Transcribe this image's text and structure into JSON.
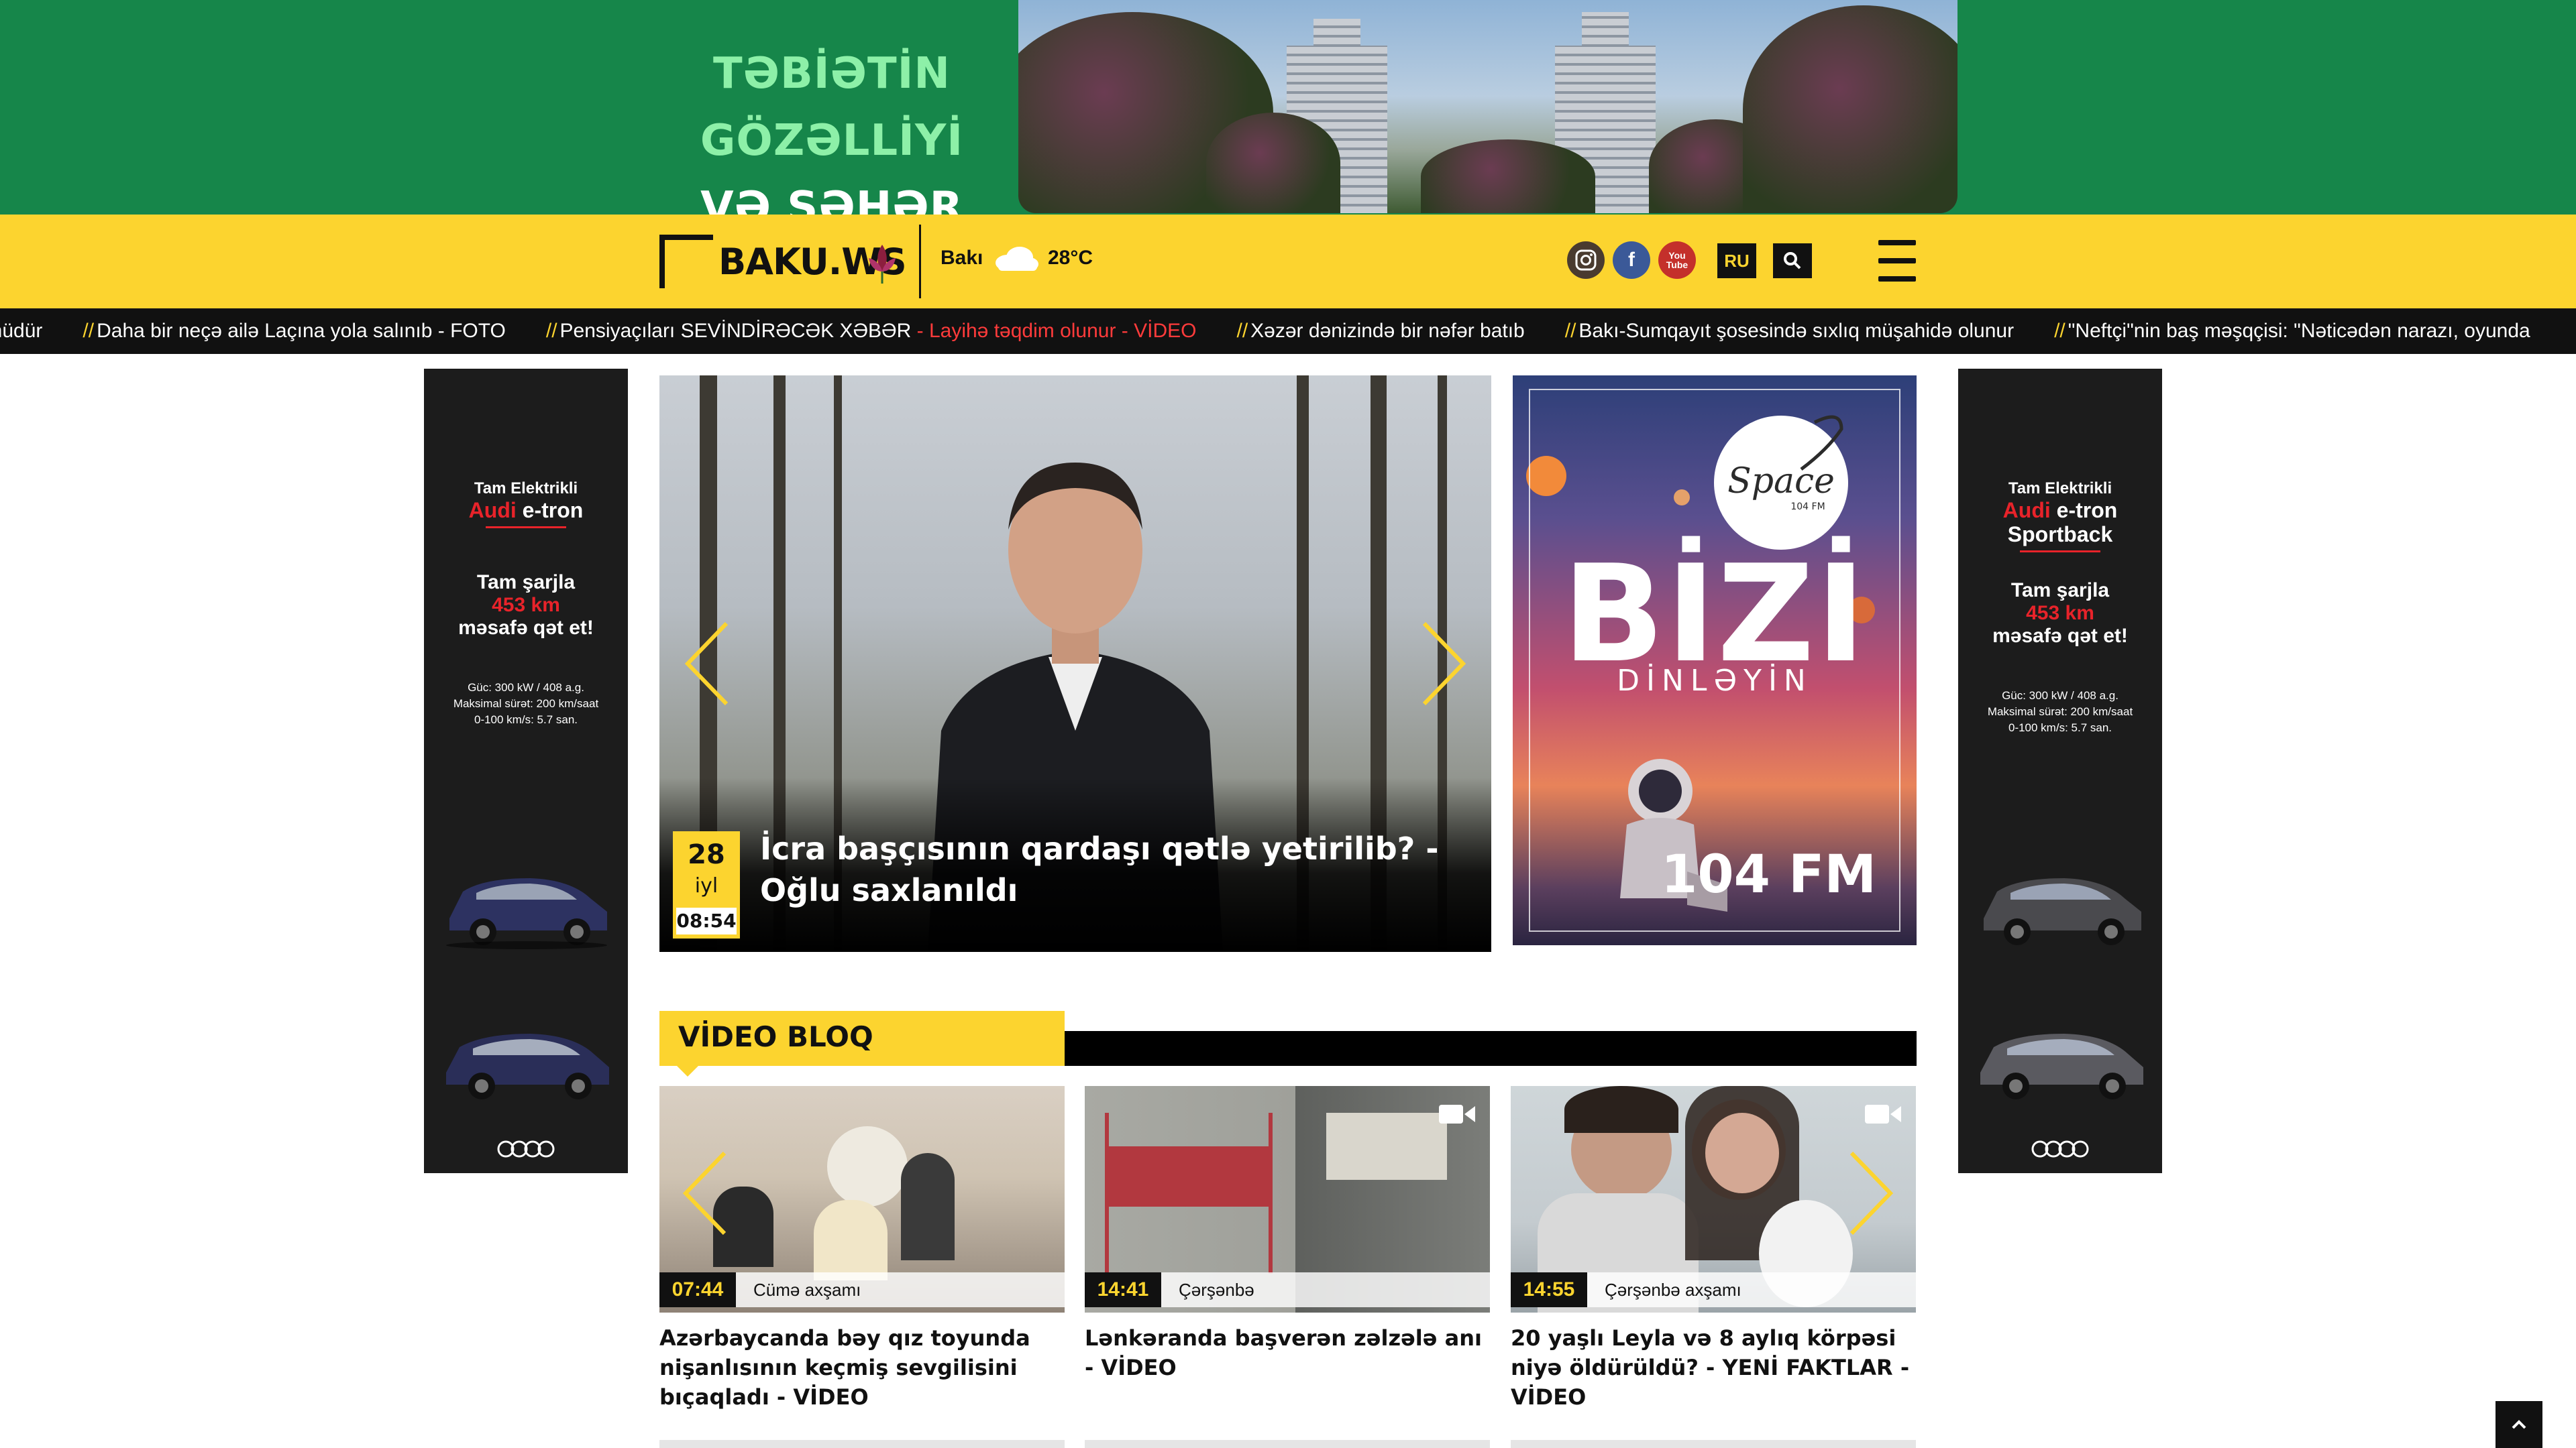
{
  "top_banner": {
    "line1": "TƏBİƏTİN GÖZƏLLİYİ",
    "line2": "VƏ ŞƏHƏR KOMFORTU"
  },
  "header": {
    "logo_text": "BAKU.WS",
    "city": "Bakı",
    "temperature": "28°C",
    "weather_icon": "cloud-icon",
    "social": [
      "instagram-icon",
      "facebook-icon",
      "youtube-icon"
    ],
    "youtube_label": "You Tube",
    "lang": "RU"
  },
  "ticker": [
    {
      "text": "ünüdür",
      "highlight": ""
    },
    {
      "text": "Daha bir neçə ailə Laçına yola salınıb - FOTO",
      "highlight": ""
    },
    {
      "text": "Pensiyaçıları SEVİNDİRƏCƏK XƏBƏR ",
      "highlight": "- Layihə təqdim olunur - VİDEO"
    },
    {
      "text": "Xəzər dənizində bir nəfər batıb",
      "highlight": ""
    },
    {
      "text": "Bakı-Sumqayıt şosesində sıxlıq müşahidə olunur",
      "highlight": ""
    },
    {
      "text": "\"Neftçi\"nin baş məşqçisi: \"Nəticədən narazı, oyunda",
      "highlight": ""
    }
  ],
  "side_ad_left": {
    "small": "Tam Elektrikli",
    "brand": "Audi",
    "model": "e-tron",
    "model2": "",
    "range1": "Tam şarjla",
    "range2": "453 km",
    "range3": "məsafə qət et!",
    "spec1": "Güc: 300 kW / 408 a.g.",
    "spec2": "Maksimal sürət: 200 km/saat",
    "spec3": "0-100 km/s: 5.7 san."
  },
  "side_ad_right": {
    "small": "Tam Elektrikli",
    "brand": "Audi",
    "model": "e-tron",
    "model2": "Sportback",
    "range1": "Tam şarjla",
    "range2": "453 km",
    "range3": "məsafə qət et!",
    "spec1": "Güc: 300 kW / 408 a.g.",
    "spec2": "Maksimal sürət: 200 km/saat",
    "spec3": "0-100 km/s: 5.7 san."
  },
  "hero": {
    "day": "28",
    "month": "iyl",
    "time": "08:54",
    "title": "İcra başçısının qardaşı qətlə yetirilib? - Oğlu saxlanıldı"
  },
  "radio_ad": {
    "logo": "Space",
    "logo_sub": "104 FM",
    "headline": "BİZİ",
    "sub": "DİNLƏYİN",
    "freq": "104 FM"
  },
  "video_bloq": {
    "title": "VİDEO BLOQ",
    "cards": [
      {
        "time": "07:44",
        "day": "Cümə axşamı",
        "title": "Azərbaycanda bəy qız toyunda nişanlısının keçmiş sevgilisini bıçaqladı - VİDEO"
      },
      {
        "time": "14:41",
        "day": "Çərşənbə",
        "title": "Lənkəranda başverən zəlzələ anı - VİDEO"
      },
      {
        "time": "14:55",
        "day": "Çərşənbə axşamı",
        "title": "20 yaşlı Leyla və 8 aylıq körpəsi niyə öldürüldü? - YENİ FAKTLAR - VİDEO"
      }
    ]
  },
  "colors": {
    "brand_yellow": "#fcd42f",
    "banner_green": "#16864a",
    "ticker_highlight": "#ff3b3b"
  }
}
